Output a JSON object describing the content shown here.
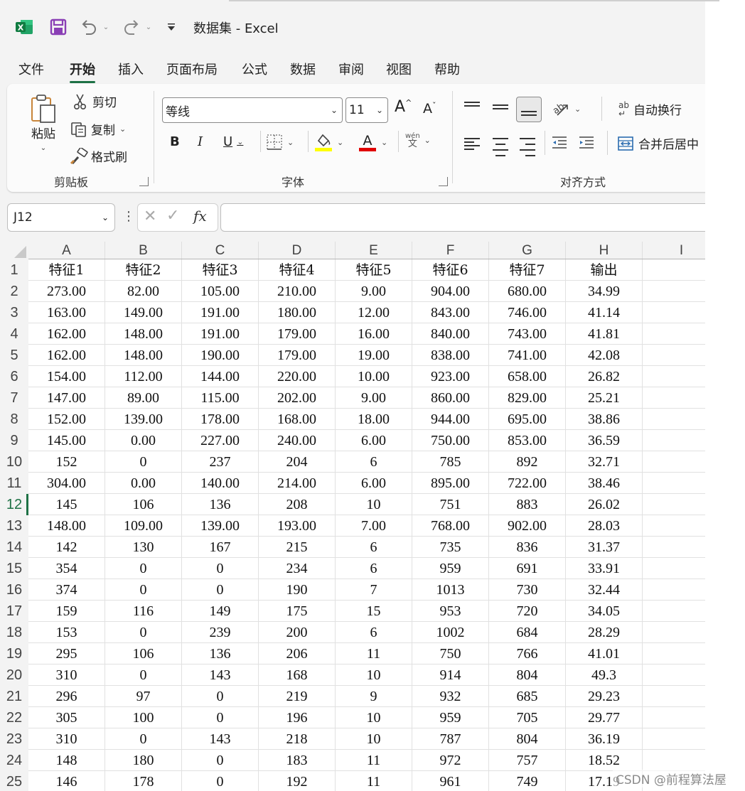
{
  "title_bar": {
    "title": "数据集  -  Excel"
  },
  "menu": {
    "tabs": [
      {
        "label": "文件"
      },
      {
        "label": "开始"
      },
      {
        "label": "插入"
      },
      {
        "label": "页面布局"
      },
      {
        "label": "公式"
      },
      {
        "label": "数据"
      },
      {
        "label": "审阅"
      },
      {
        "label": "视图"
      },
      {
        "label": "帮助"
      }
    ],
    "active": "开始"
  },
  "ribbon": {
    "clipboard": {
      "paste": "粘贴",
      "cut": "剪切",
      "copy": "复制",
      "format_painter": "格式刷",
      "label": "剪贴板"
    },
    "font": {
      "name": "等线",
      "size": "11",
      "grow": "A",
      "shrink": "A",
      "bold": "B",
      "italic": "I",
      "underline": "U",
      "font_color": "A",
      "phonetic_top": "wén",
      "phonetic_bottom": "文",
      "label": "字体"
    },
    "alignment": {
      "wrap_text": "自动换行",
      "merge_center": "合并后居中",
      "wrap_glyph": "ab",
      "label": "对齐方式"
    }
  },
  "formula_bar": {
    "name_box": "J12",
    "fx": "fx",
    "formula": ""
  },
  "sheet": {
    "columns": [
      "A",
      "B",
      "C",
      "D",
      "E",
      "F",
      "G",
      "H",
      "I"
    ],
    "selected_row": "12",
    "rows": [
      {
        "n": "1",
        "cells": [
          "特征1",
          "特征2",
          "特征3",
          "特征4",
          "特征5",
          "特征6",
          "特征7",
          "输出",
          ""
        ]
      },
      {
        "n": "2",
        "cells": [
          "273.00",
          "82.00",
          "105.00",
          "210.00",
          "9.00",
          "904.00",
          "680.00",
          "34.99",
          ""
        ]
      },
      {
        "n": "3",
        "cells": [
          "163.00",
          "149.00",
          "191.00",
          "180.00",
          "12.00",
          "843.00",
          "746.00",
          "41.14",
          ""
        ]
      },
      {
        "n": "4",
        "cells": [
          "162.00",
          "148.00",
          "191.00",
          "179.00",
          "16.00",
          "840.00",
          "743.00",
          "41.81",
          ""
        ]
      },
      {
        "n": "5",
        "cells": [
          "162.00",
          "148.00",
          "190.00",
          "179.00",
          "19.00",
          "838.00",
          "741.00",
          "42.08",
          ""
        ]
      },
      {
        "n": "6",
        "cells": [
          "154.00",
          "112.00",
          "144.00",
          "220.00",
          "10.00",
          "923.00",
          "658.00",
          "26.82",
          ""
        ]
      },
      {
        "n": "7",
        "cells": [
          "147.00",
          "89.00",
          "115.00",
          "202.00",
          "9.00",
          "860.00",
          "829.00",
          "25.21",
          ""
        ]
      },
      {
        "n": "8",
        "cells": [
          "152.00",
          "139.00",
          "178.00",
          "168.00",
          "18.00",
          "944.00",
          "695.00",
          "38.86",
          ""
        ]
      },
      {
        "n": "9",
        "cells": [
          "145.00",
          "0.00",
          "227.00",
          "240.00",
          "6.00",
          "750.00",
          "853.00",
          "36.59",
          ""
        ]
      },
      {
        "n": "10",
        "cells": [
          "152",
          "0",
          "237",
          "204",
          "6",
          "785",
          "892",
          "32.71",
          ""
        ]
      },
      {
        "n": "11",
        "cells": [
          "304.00",
          "0.00",
          "140.00",
          "214.00",
          "6.00",
          "895.00",
          "722.00",
          "38.46",
          ""
        ]
      },
      {
        "n": "12",
        "cells": [
          "145",
          "106",
          "136",
          "208",
          "10",
          "751",
          "883",
          "26.02",
          ""
        ]
      },
      {
        "n": "13",
        "cells": [
          "148.00",
          "109.00",
          "139.00",
          "193.00",
          "7.00",
          "768.00",
          "902.00",
          "28.03",
          ""
        ]
      },
      {
        "n": "14",
        "cells": [
          "142",
          "130",
          "167",
          "215",
          "6",
          "735",
          "836",
          "31.37",
          ""
        ]
      },
      {
        "n": "15",
        "cells": [
          "354",
          "0",
          "0",
          "234",
          "6",
          "959",
          "691",
          "33.91",
          ""
        ]
      },
      {
        "n": "16",
        "cells": [
          "374",
          "0",
          "0",
          "190",
          "7",
          "1013",
          "730",
          "32.44",
          ""
        ]
      },
      {
        "n": "17",
        "cells": [
          "159",
          "116",
          "149",
          "175",
          "15",
          "953",
          "720",
          "34.05",
          ""
        ]
      },
      {
        "n": "18",
        "cells": [
          "153",
          "0",
          "239",
          "200",
          "6",
          "1002",
          "684",
          "28.29",
          ""
        ]
      },
      {
        "n": "19",
        "cells": [
          "295",
          "106",
          "136",
          "206",
          "11",
          "750",
          "766",
          "41.01",
          ""
        ]
      },
      {
        "n": "20",
        "cells": [
          "310",
          "0",
          "143",
          "168",
          "10",
          "914",
          "804",
          "49.3",
          ""
        ]
      },
      {
        "n": "21",
        "cells": [
          "296",
          "97",
          "0",
          "219",
          "9",
          "932",
          "685",
          "29.23",
          ""
        ]
      },
      {
        "n": "22",
        "cells": [
          "305",
          "100",
          "0",
          "196",
          "10",
          "959",
          "705",
          "29.77",
          ""
        ]
      },
      {
        "n": "23",
        "cells": [
          "310",
          "0",
          "143",
          "218",
          "10",
          "787",
          "804",
          "36.19",
          ""
        ]
      },
      {
        "n": "24",
        "cells": [
          "148",
          "180",
          "0",
          "183",
          "11",
          "972",
          "757",
          "18.52",
          ""
        ]
      },
      {
        "n": "25",
        "cells": [
          "146",
          "178",
          "0",
          "192",
          "11",
          "961",
          "749",
          "17.19",
          ""
        ]
      }
    ]
  },
  "watermark": "CSDN @前程算法屋",
  "colors": {
    "excel_green": "#1e7145",
    "save_purple": "#8a3fb5",
    "highlight_yellow": "#ffff00",
    "font_red": "#e00000"
  }
}
